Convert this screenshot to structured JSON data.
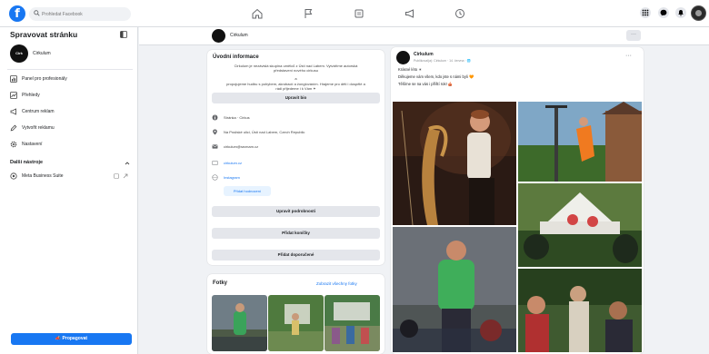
{
  "topbar": {
    "logo": "f",
    "search_placeholder": "Prohledat Facebook",
    "nav_icons": [
      "home-icon",
      "flag-icon",
      "pages-icon",
      "megaphone-icon",
      "clock-icon"
    ],
    "right_icons": [
      "grid-icon",
      "messenger-icon",
      "bell-icon"
    ]
  },
  "sidebar": {
    "title": "Spravovat stránku",
    "page_avatar_text": "Cirk",
    "page_name": "Cirkulum",
    "items": [
      {
        "label": "Panel pro profesionály",
        "icon": "dashboard-icon"
      },
      {
        "label": "Přehledy",
        "icon": "insights-icon"
      },
      {
        "label": "Centrum reklam",
        "icon": "megaphone-icon"
      },
      {
        "label": "Vytvořit reklamu",
        "icon": "edit-icon"
      },
      {
        "label": "Nastavení",
        "icon": "gear-icon"
      }
    ],
    "section_title": "Další nástroje",
    "business_item": "Meta Business Suite",
    "promote_label": "Propagovat"
  },
  "pagebar": {
    "name": "Cirkulum",
    "more": "···"
  },
  "about": {
    "title": "Úvodní informace",
    "intro_lines": [
      "Cirkulum je nezávislá skupina umělců z Ústí nad Labem. Vytváříme autorská představení nového cirkusu",
      "a",
      "propojujeme hudbu s pohybem, akrobacií a žonglováním. Hrajeme pro děti i dospělé a rádi přijedeme i k Vám ✦"
    ],
    "edit_bio": "Upravit bio",
    "category": "Stránka · Cirkus",
    "address": "Na Pražské ulici, Ústí nad Labem, Czech Republic",
    "email": "cirkulum@seznam.cz",
    "web": "cirkulum.cz",
    "web2": "Instagram",
    "rating_chip": "Přidat hodnocení",
    "btn_details": "Upravit podrobnosti",
    "btn_hobbies": "Přidat koníčky",
    "btn_featured": "Přidat doporučené"
  },
  "photos": {
    "title": "Fotky",
    "see_all": "Zobrazit všechny fotky"
  },
  "post": {
    "name": "Cirkulum",
    "meta": "Publikoval(a): Cirkulum · 14. června · 🌐",
    "more": "···",
    "lines": [
      "Krásné léto ☀",
      "Děkujeme vám všem, kdo jste s námi byli 🧡",
      "Těšíme se na vás i příští rok! 🎪"
    ]
  }
}
